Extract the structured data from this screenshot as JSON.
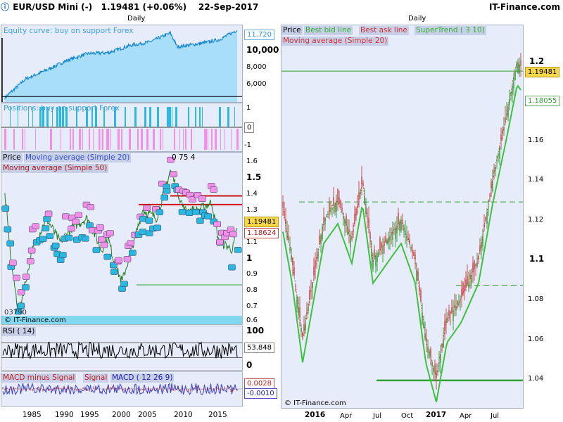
{
  "header": {
    "symbol": "EUR/USD Mini (-)",
    "price": "1.19481 (+0.06%)",
    "date": "22-Sep-2017",
    "brand": "IT-Finance.com"
  },
  "left": {
    "period": "Daily",
    "equity": {
      "label": "Equity curve: buy on support Forex",
      "ticks": [
        "10,000",
        "8,000",
        "6,000"
      ],
      "tag": "11.720"
    },
    "positions": {
      "label": "Positions: buy on support Forex",
      "ticks": [
        "1",
        "0",
        "-1"
      ]
    },
    "price": {
      "labels": [
        "Price",
        "Moving average (Simple 20)",
        "Moving average (Simple 50)"
      ],
      "extra": "0  75  4",
      "ticks": [
        "1.6",
        "1.5",
        "1.4",
        "1.3",
        "1.2",
        "1.1",
        "1",
        "0.9",
        "0.8",
        "0.7",
        "0.6"
      ],
      "tag_price": "1.19481",
      "tag_ma": "1.18624",
      "copyright": "© IT-Finance.com",
      "bottom_text": "03790"
    },
    "rsi": {
      "label": "RSI ( 14)",
      "ticks": [
        "100",
        "50",
        "0"
      ],
      "tag": "53.848"
    },
    "macd": {
      "labels": [
        "MACD minus Signal",
        "Signal",
        "MACD ( 12 26 9)"
      ],
      "tag1": "0.0028",
      "tag2": "-0.0010"
    },
    "xaxis": [
      "1985",
      "1990",
      "1995",
      "2000",
      "2005",
      "2010",
      "2015"
    ]
  },
  "right": {
    "period": "Daily",
    "labels": [
      "Price",
      "Best bid line",
      "Best ask line",
      "SuperTrend ( 3 10)",
      "Moving average (Simple 20)"
    ],
    "ticks": [
      "1.2",
      "1.16",
      "1.14",
      "1.12",
      "1.1",
      "1.08",
      "1.06",
      "1.04"
    ],
    "tag_price": "1.19481",
    "tag_st": "1.18055",
    "copyright": "© IT-Finance.com",
    "xaxis": [
      "2016",
      "Apr",
      "Jul",
      "Oct",
      "2017",
      "Apr",
      "Jul"
    ]
  },
  "chart_data": [
    {
      "type": "area",
      "title": "Equity curve: buy on support Forex",
      "x": [
        1984,
        1987,
        1990,
        1993,
        1996,
        1999,
        2002,
        2005,
        2008,
        2009,
        2012,
        2015,
        2017.7
      ],
      "values": [
        4800,
        6700,
        7600,
        8600,
        9300,
        9400,
        10100,
        10500,
        11400,
        10000,
        10300,
        10700,
        11720
      ],
      "ylim": [
        4200,
        12200
      ]
    },
    {
      "type": "line",
      "title": "Price",
      "x": [
        1984,
        1985,
        1986,
        1988,
        1990,
        1992,
        1994,
        1996,
        1998,
        1999,
        2000,
        2001,
        2002,
        2004,
        2006,
        2008,
        2010,
        2012,
        2014,
        2015,
        2016,
        2017,
        2017.7
      ],
      "values": [
        1.4,
        0.95,
        0.65,
        1.05,
        1.25,
        1.1,
        1.2,
        1.25,
        1.05,
        1.12,
        0.95,
        0.85,
        1.0,
        1.3,
        1.25,
        1.55,
        1.3,
        1.3,
        1.35,
        1.1,
        1.08,
        1.05,
        1.19
      ],
      "ylim": [
        0.55,
        1.65
      ]
    },
    {
      "type": "line",
      "title": "RSI ( 14)",
      "values": [
        53.848
      ],
      "ylim": [
        0,
        100
      ]
    },
    {
      "type": "line",
      "title": "Price",
      "x": [
        "2016",
        "Apr",
        "Jul",
        "Oct",
        "2017",
        "Apr",
        "Jul"
      ],
      "values": [
        1.09,
        1.13,
        1.11,
        1.12,
        1.05,
        1.07,
        1.18
      ],
      "ylim": [
        1.03,
        1.22
      ]
    }
  ]
}
